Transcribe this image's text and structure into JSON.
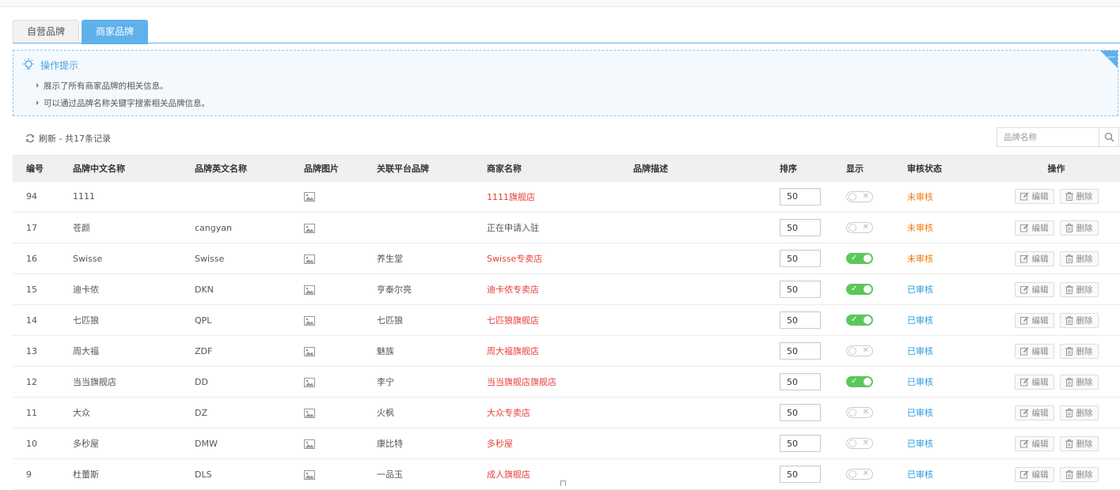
{
  "tabs": [
    {
      "label": "自营品牌",
      "active": false
    },
    {
      "label": "商家品牌",
      "active": true
    }
  ],
  "tips": {
    "title": "操作提示",
    "corner_symbol": "—",
    "items": [
      "展示了所有商家品牌的相关信息。",
      "可以通过品牌名称关键字搜索相关品牌信息。"
    ]
  },
  "toolbar": {
    "refresh_label": "刷新 - 共17条记录"
  },
  "search": {
    "placeholder": "品牌名称",
    "icon": "search-icon"
  },
  "colors": {
    "accent": "#5fb1ec",
    "red_link": "#e5413e",
    "pending": "#f0780a",
    "approved": "#2b9ce0",
    "toggle_on": "#5bc75b"
  },
  "table": {
    "headers": [
      "编号",
      "品牌中文名称",
      "品牌英文名称",
      "品牌图片",
      "关联平台品牌",
      "商家名称",
      "品牌描述",
      "排序",
      "显示",
      "审核状态",
      "操作"
    ],
    "edit_label": "编辑",
    "delete_label": "删除",
    "rows": [
      {
        "id": "94",
        "cn": "1111",
        "en": "",
        "platform": "",
        "shop": "1111旗舰店",
        "shop_red": true,
        "desc": "",
        "sort": "50",
        "show": false,
        "status": "未审核",
        "approved": false
      },
      {
        "id": "17",
        "cn": "苍颜",
        "en": "cangyan",
        "platform": "",
        "shop": "正在申请入驻",
        "shop_red": false,
        "desc": "",
        "sort": "50",
        "show": false,
        "status": "未审核",
        "approved": false
      },
      {
        "id": "16",
        "cn": "Swisse",
        "en": "Swisse",
        "platform": "养生堂",
        "shop": "Swisse专卖店",
        "shop_red": true,
        "desc": "",
        "sort": "50",
        "show": true,
        "status": "未审核",
        "approved": false
      },
      {
        "id": "15",
        "cn": "迪卡侬",
        "en": "DKN",
        "platform": "亨泰尔亮",
        "shop": "迪卡侬专卖店",
        "shop_red": true,
        "desc": "",
        "sort": "50",
        "show": true,
        "status": "已审核",
        "approved": true
      },
      {
        "id": "14",
        "cn": "七匹狼",
        "en": "QPL",
        "platform": "七匹狼",
        "shop": "七匹狼旗舰店",
        "shop_red": true,
        "desc": "",
        "sort": "50",
        "show": true,
        "status": "已审核",
        "approved": true
      },
      {
        "id": "13",
        "cn": "周大福",
        "en": "ZDF",
        "platform": "魅族",
        "shop": "周大福旗舰店",
        "shop_red": true,
        "desc": "",
        "sort": "50",
        "show": false,
        "status": "已审核",
        "approved": true
      },
      {
        "id": "12",
        "cn": "当当旗舰店",
        "en": "DD",
        "platform": "李宁",
        "shop": "当当旗舰店旗舰店",
        "shop_red": true,
        "desc": "",
        "sort": "50",
        "show": true,
        "status": "已审核",
        "approved": true
      },
      {
        "id": "11",
        "cn": "大众",
        "en": "DZ",
        "platform": "火枫",
        "shop": "大众专卖店",
        "shop_red": true,
        "desc": "",
        "sort": "50",
        "show": false,
        "status": "已审核",
        "approved": true
      },
      {
        "id": "10",
        "cn": "多秒屋",
        "en": "DMW",
        "platform": "康比特",
        "shop": "多秒屋",
        "shop_red": true,
        "desc": "",
        "sort": "50",
        "show": false,
        "status": "已审核",
        "approved": true
      },
      {
        "id": "9",
        "cn": "杜蕾斯",
        "en": "DLS",
        "platform": "一品玉",
        "shop": "成人旗舰店",
        "shop_red": true,
        "desc": "",
        "sort": "50",
        "show": false,
        "status": "已审核",
        "approved": true
      }
    ]
  }
}
